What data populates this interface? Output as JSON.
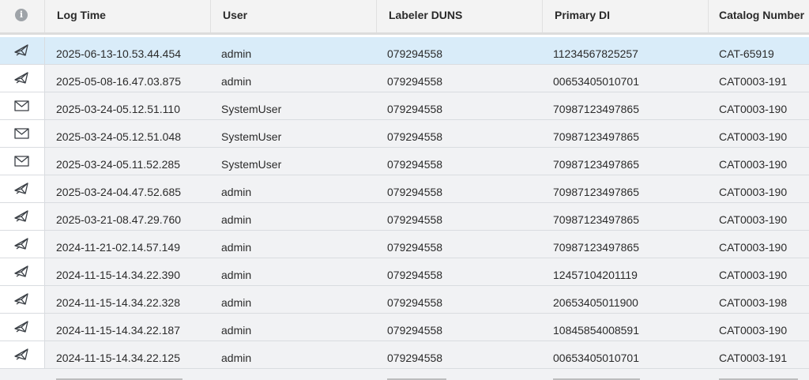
{
  "columns": {
    "info_icon": "info-icon",
    "log_time": "Log Time",
    "user": "User",
    "labeler_duns": "Labeler DUNS",
    "primary_di": "Primary DI",
    "catalog_number": "Catalog Number"
  },
  "rows": [
    {
      "icon": "sent-envelope-icon",
      "log_time": "2025-06-13-10.53.44.454",
      "user": "admin",
      "labeler_duns": "079294558",
      "primary_di": "11234567825257",
      "catalog_number": "CAT-65919",
      "selected": true
    },
    {
      "icon": "sent-envelope-icon",
      "log_time": "2025-05-08-16.47.03.875",
      "user": "admin",
      "labeler_duns": "079294558",
      "primary_di": "00653405010701",
      "catalog_number": "CAT0003-191"
    },
    {
      "icon": "envelope-icon",
      "log_time": "2025-03-24-05.12.51.110",
      "user": "SystemUser",
      "labeler_duns": "079294558",
      "primary_di": "70987123497865",
      "catalog_number": "CAT0003-190"
    },
    {
      "icon": "envelope-icon",
      "log_time": "2025-03-24-05.12.51.048",
      "user": "SystemUser",
      "labeler_duns": "079294558",
      "primary_di": "70987123497865",
      "catalog_number": "CAT0003-190"
    },
    {
      "icon": "envelope-icon",
      "log_time": "2025-03-24-05.11.52.285",
      "user": "SystemUser",
      "labeler_duns": "079294558",
      "primary_di": "70987123497865",
      "catalog_number": "CAT0003-190"
    },
    {
      "icon": "sent-envelope-icon",
      "log_time": "2025-03-24-04.47.52.685",
      "user": "admin",
      "labeler_duns": "079294558",
      "primary_di": "70987123497865",
      "catalog_number": "CAT0003-190"
    },
    {
      "icon": "sent-envelope-icon",
      "log_time": "2025-03-21-08.47.29.760",
      "user": "admin",
      "labeler_duns": "079294558",
      "primary_di": "70987123497865",
      "catalog_number": "CAT0003-190"
    },
    {
      "icon": "sent-envelope-icon",
      "log_time": "2024-11-21-02.14.57.149",
      "user": "admin",
      "labeler_duns": "079294558",
      "primary_di": "70987123497865",
      "catalog_number": "CAT0003-190"
    },
    {
      "icon": "sent-envelope-icon",
      "log_time": "2024-11-15-14.34.22.390",
      "user": "admin",
      "labeler_duns": "079294558",
      "primary_di": "12457104201119",
      "catalog_number": "CAT0003-190"
    },
    {
      "icon": "sent-envelope-icon",
      "log_time": "2024-11-15-14.34.22.328",
      "user": "admin",
      "labeler_duns": "079294558",
      "primary_di": "20653405011900",
      "catalog_number": "CAT0003-198"
    },
    {
      "icon": "sent-envelope-icon",
      "log_time": "2024-11-15-14.34.22.187",
      "user": "admin",
      "labeler_duns": "079294558",
      "primary_di": "10845854008591",
      "catalog_number": "CAT0003-190"
    },
    {
      "icon": "sent-envelope-icon",
      "log_time": "2024-11-15-14.34.22.125",
      "user": "admin",
      "labeler_duns": "079294558",
      "primary_di": "00653405010701",
      "catalog_number": "CAT0003-191"
    }
  ],
  "colors": {
    "header_bg": "#f3f3f3",
    "row_bg": "#f1f2f4",
    "selected_row_bg": "#d9ecf9",
    "icon_stroke": "#3a3f45"
  }
}
